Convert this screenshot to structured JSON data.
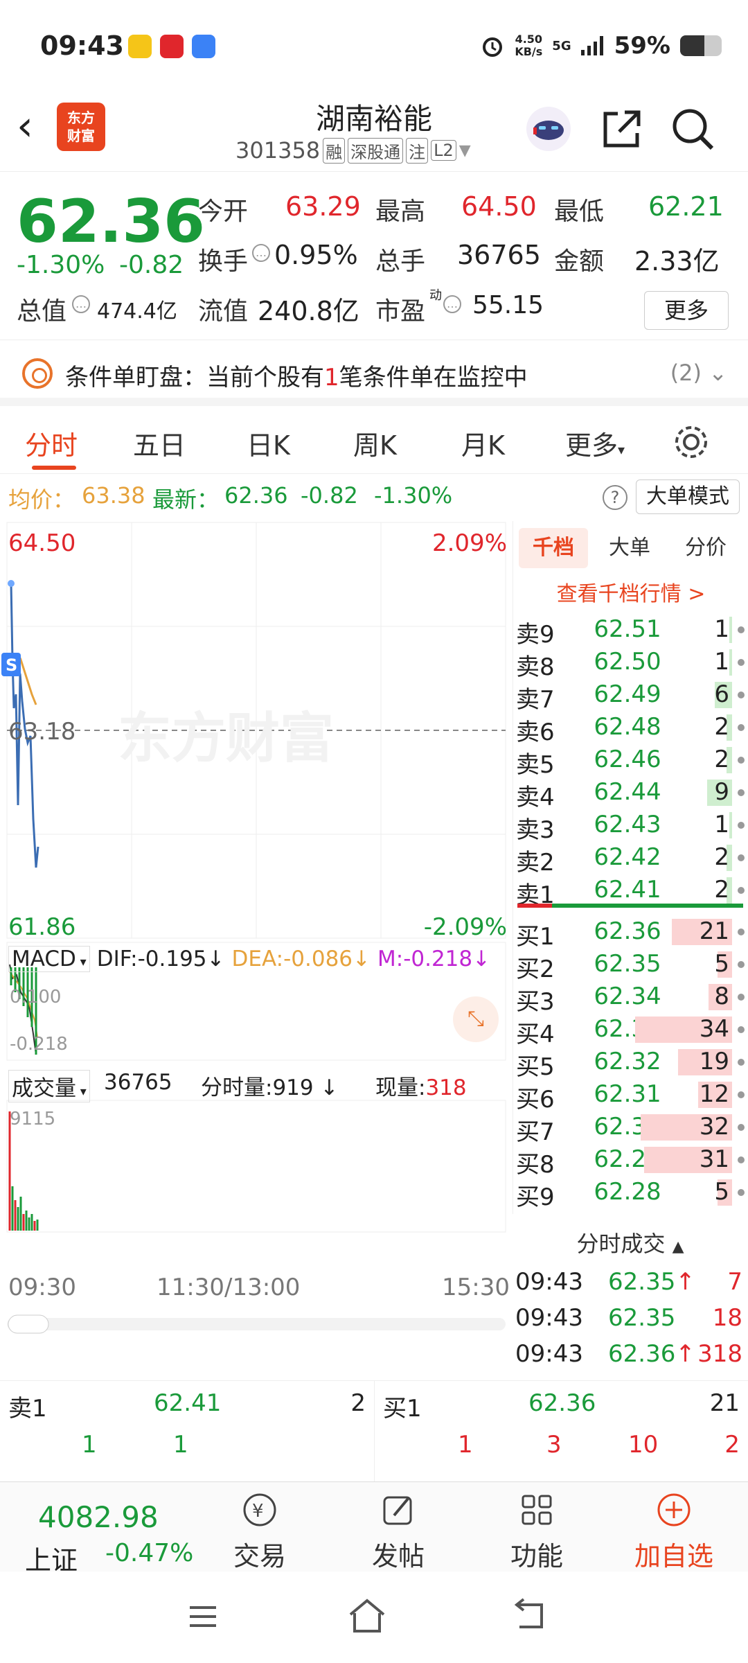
{
  "status_bar": {
    "time": "09:43",
    "net_speed": "4.50",
    "net_unit": "KB/s",
    "signal": "5G",
    "battery": "59%",
    "battery_level": 0.59
  },
  "header": {
    "name": "湖南裕能",
    "code": "301358",
    "tags": [
      "融",
      "深股通",
      "注",
      "L2"
    ],
    "logo_text": "东方财富"
  },
  "quote": {
    "price": "62.36",
    "change_pct": "-1.30%",
    "change": "-0.82",
    "open_label": "今开",
    "open": "63.29",
    "high_label": "最高",
    "high": "64.50",
    "low_label": "最低",
    "low": "62.21",
    "turnover_label": "换手",
    "turnover": "0.95%",
    "volume_label": "总手",
    "volume": "36765",
    "amount_label": "金额",
    "amount": "2.33亿",
    "mktcap_label": "总值",
    "mktcap": "474.4亿",
    "float_label": "流值",
    "float_cap": "240.8亿",
    "pe_label": "市盈",
    "pe_sup": "动",
    "pe": "55.15",
    "more": "更多"
  },
  "alert": {
    "text_a": "条件单盯盘：当前个股有",
    "num": "1",
    "text_b": "笔条件单在监控中",
    "count": "(2)"
  },
  "tabs": [
    "分时",
    "五日",
    "日K",
    "周K",
    "月K",
    "更多"
  ],
  "intraday": {
    "avg_label": "均价：",
    "avg": "63.38",
    "last_label": "最新：",
    "last": "62.36",
    "chg": "-0.82",
    "chg_pct": "-1.30%",
    "mode_btn": "大单模式",
    "help": "?",
    "top_price": "64.50",
    "top_pct": "2.09%",
    "mid_price": "63.18",
    "bottom_price": "61.86",
    "bottom_pct": "-2.09%",
    "watermark": "东方财富",
    "s_marker": "S",
    "time_labels": [
      "09:30",
      "11:30/13:00",
      "15:30"
    ]
  },
  "macd": {
    "name": "MACD",
    "dif": "DIF:-0.195",
    "dea": "DEA:-0.086",
    "m": "M:-0.218",
    "top": "0.100",
    "bottom": "-0.218",
    "arrow": "↓"
  },
  "vol": {
    "name": "成交量",
    "total": "36765",
    "min_label": "分时量:919",
    "cur_label": "现量:",
    "cur": "318",
    "top": "9115"
  },
  "book": {
    "tabs": [
      "千档",
      "大单",
      "分价"
    ],
    "link": "查看千档行情 >",
    "asks": [
      {
        "label": "卖9",
        "price": "62.51",
        "qty": "1",
        "level": 0.03
      },
      {
        "label": "卖8",
        "price": "62.50",
        "qty": "1",
        "level": 0.03
      },
      {
        "label": "卖7",
        "price": "62.49",
        "qty": "6",
        "level": 0.18
      },
      {
        "label": "卖6",
        "price": "62.48",
        "qty": "2",
        "level": 0.06
      },
      {
        "label": "卖5",
        "price": "62.46",
        "qty": "2",
        "level": 0.06
      },
      {
        "label": "卖4",
        "price": "62.44",
        "qty": "9",
        "level": 0.26
      },
      {
        "label": "卖3",
        "price": "62.43",
        "qty": "1",
        "level": 0.03
      },
      {
        "label": "卖2",
        "price": "62.42",
        "qty": "2",
        "level": 0.06
      },
      {
        "label": "卖1",
        "price": "62.41",
        "qty": "2",
        "level": 0.06
      }
    ],
    "bids": [
      {
        "label": "买1",
        "price": "62.36",
        "qty": "21",
        "level": 0.62
      },
      {
        "label": "买2",
        "price": "62.35",
        "qty": "5",
        "level": 0.15
      },
      {
        "label": "买3",
        "price": "62.34",
        "qty": "8",
        "level": 0.24
      },
      {
        "label": "买4",
        "price": "62.33",
        "qty": "34",
        "level": 1.0
      },
      {
        "label": "买5",
        "price": "62.32",
        "qty": "19",
        "level": 0.56
      },
      {
        "label": "买6",
        "price": "62.31",
        "qty": "12",
        "level": 0.35
      },
      {
        "label": "买7",
        "price": "62.30",
        "qty": "32",
        "level": 0.94
      },
      {
        "label": "买8",
        "price": "62.29",
        "qty": "31",
        "level": 0.91
      },
      {
        "label": "买9",
        "price": "62.28",
        "qty": "5",
        "level": 0.15
      }
    ]
  },
  "ticks": {
    "title": "分时成交",
    "rows": [
      {
        "time": "09:43",
        "price": "62.35",
        "arrow": "↑",
        "vol": "7"
      },
      {
        "time": "09:43",
        "price": "62.35",
        "arrow": "",
        "vol": "18"
      },
      {
        "time": "09:43",
        "price": "62.36",
        "arrow": "↑",
        "vol": "318"
      }
    ]
  },
  "level1": {
    "ask_label": "卖1",
    "ask_price": "62.41",
    "ask_qty": "2",
    "ask_detail": [
      "1",
      "1"
    ],
    "bid_label": "买1",
    "bid_price": "62.36",
    "bid_qty": "21",
    "bid_detail": [
      "1",
      "3",
      "10",
      "2"
    ]
  },
  "bottom_bar": {
    "index_value": "4082.98",
    "index_name": "上证",
    "index_chg": "-0.47%",
    "items": [
      "交易",
      "发帖",
      "功能",
      "加自选"
    ]
  },
  "colors": {
    "red": "#e0262c",
    "green": "#1a9a3a",
    "accent": "#e8441f",
    "blue": "#3b6db3",
    "avg_line": "#e6a23c"
  }
}
